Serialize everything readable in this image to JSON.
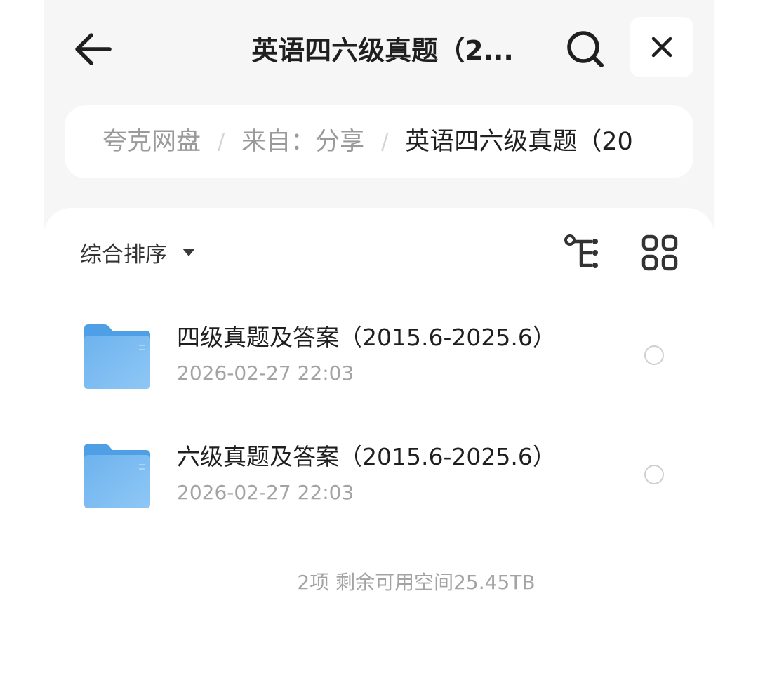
{
  "header": {
    "title": "英语四六级真题（2..."
  },
  "breadcrumb": {
    "items": [
      "夸克网盘",
      "来自：分享",
      "英语四六级真题（20"
    ],
    "separator": "/"
  },
  "toolbar": {
    "sort_label": "综合排序"
  },
  "files": [
    {
      "name": "四级真题及答案（2015.6-2025.6）",
      "date": "2026-02-27 22:03"
    },
    {
      "name": "六级真题及答案（2015.6-2025.6）",
      "date": "2026-02-27 22:03"
    }
  ],
  "footer": {
    "summary": "2项 剩余可用空间25.45TB"
  },
  "colors": {
    "folder_blue": "#6db3ee",
    "background_gray": "#f6f6f7"
  }
}
